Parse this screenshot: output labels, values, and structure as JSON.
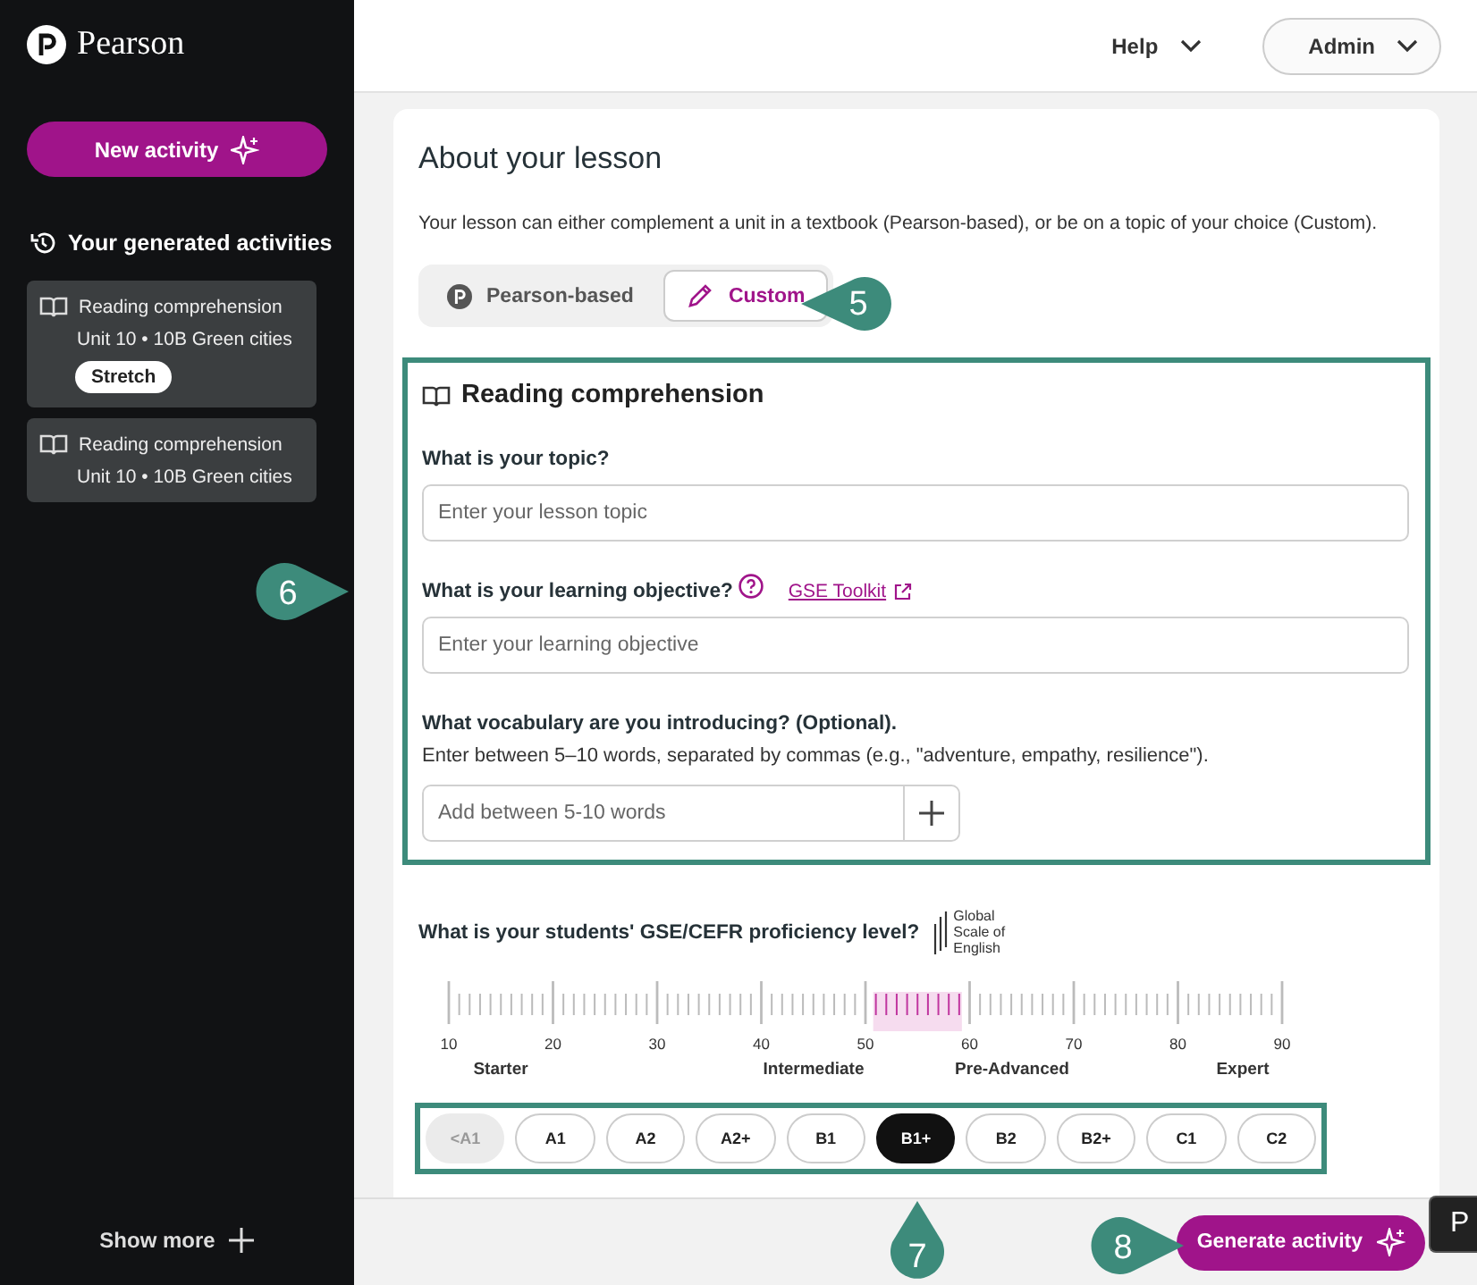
{
  "sidebar": {
    "logo_text": "Pearson",
    "new_button": "New activity",
    "history_title": "Your generated activities",
    "activities": [
      {
        "title": "Reading comprehension",
        "subtitle": "Unit 10 • 10B Green cities",
        "tag": "Stretch"
      },
      {
        "title": "Reading comprehension",
        "subtitle": "Unit 10 • 10B Green cities"
      }
    ],
    "show_more": "Show more"
  },
  "header": {
    "menus": [
      {
        "label": "Help",
        "kind": "link"
      },
      {
        "label": "Admin",
        "kind": "pill"
      }
    ]
  },
  "lesson": {
    "title": "About your lesson",
    "description": "Your lesson can either complement a unit in a textbook (Pearson-based), or be on a topic of your choice (Custom).",
    "source_tabs": [
      {
        "label": "Pearson-based",
        "kind": "pearson",
        "selected": false
      },
      {
        "label": "Custom",
        "kind": "custom",
        "selected": true
      }
    ]
  },
  "activity_form": {
    "title": "Reading comprehension",
    "fields": [
      {
        "kind": "text",
        "label": "What is your topic?",
        "placeholder": "Enter your lesson topic"
      },
      {
        "kind": "text",
        "label": "What is your learning objective?",
        "help": true,
        "link": "GSE Toolkit",
        "placeholder": "Enter your learning objective"
      },
      {
        "kind": "add",
        "label": "What vocabulary are you introducing? (Optional).",
        "hint": "Enter between 5–10 words, separated by commas (e.g., \"adventure, empathy, resilience\").",
        "placeholder": "Add between 5-10 words"
      }
    ]
  },
  "proficiency": {
    "question": "What is your students' GSE/CEFR proficiency level?",
    "gse_logo": [
      "Global",
      "Scale of",
      "English"
    ],
    "scale": {
      "numbers": [
        "10",
        "20",
        "30",
        "40",
        "50",
        "60",
        "70",
        "80",
        "90"
      ],
      "bands": [
        {
          "label": "Starter"
        },
        {
          "label": "Intermediate"
        },
        {
          "label": "Pre-Advanced"
        },
        {
          "label": "Expert"
        }
      ]
    },
    "levels": [
      {
        "label": "<A1",
        "disabled": true,
        "selected": false
      },
      {
        "label": "A1",
        "disabled": false,
        "selected": false
      },
      {
        "label": "A2",
        "disabled": false,
        "selected": false
      },
      {
        "label": "A2+",
        "disabled": false,
        "selected": false
      },
      {
        "label": "B1",
        "disabled": false,
        "selected": false
      },
      {
        "label": "B1+",
        "disabled": false,
        "selected": true
      },
      {
        "label": "B2",
        "disabled": false,
        "selected": false
      },
      {
        "label": "B2+",
        "disabled": false,
        "selected": false
      },
      {
        "label": "C1",
        "disabled": false,
        "selected": false
      },
      {
        "label": "C2",
        "disabled": false,
        "selected": false
      }
    ]
  },
  "footer": {
    "generate_button": "Generate activity"
  },
  "callouts": [
    {
      "number": "5",
      "kind": "left"
    },
    {
      "number": "6",
      "kind": "right"
    },
    {
      "number": "7",
      "kind": "up"
    },
    {
      "number": "8",
      "kind": "right"
    }
  ],
  "edge_tooltip": "P"
}
